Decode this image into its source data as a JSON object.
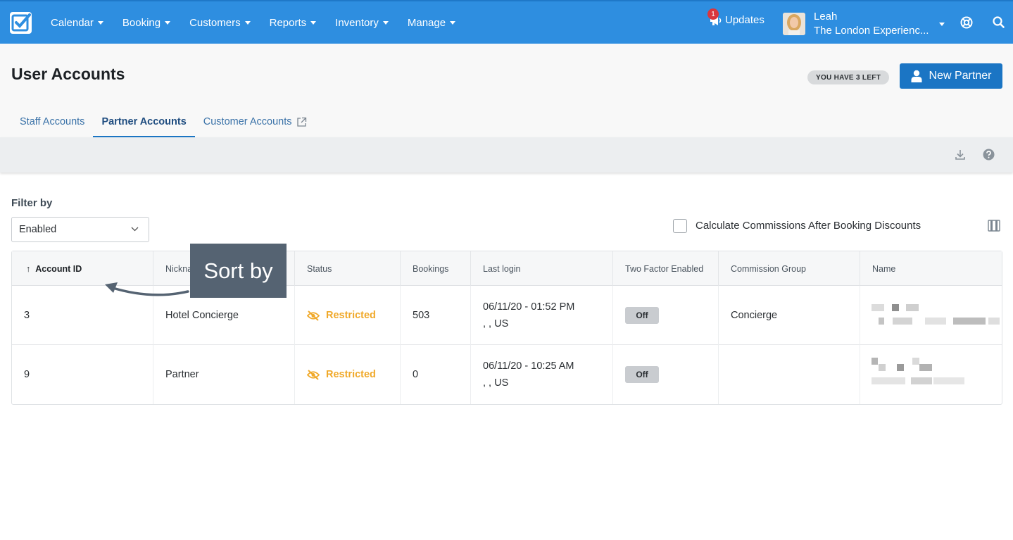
{
  "nav": {
    "items": [
      {
        "label": "Calendar"
      },
      {
        "label": "Booking"
      },
      {
        "label": "Customers"
      },
      {
        "label": "Reports"
      },
      {
        "label": "Inventory"
      },
      {
        "label": "Manage"
      }
    ],
    "updates_label": "Updates",
    "updates_count": "1",
    "user_name": "Leah",
    "user_company": "The London Experienc...",
    "icons": [
      "checkbox-logo-icon",
      "megaphone-icon",
      "lifebuoy-icon",
      "search-icon"
    ]
  },
  "page": {
    "title": "User Accounts",
    "remaining_label": "YOU HAVE 3 LEFT",
    "new_partner_label": "New Partner",
    "tabs": [
      {
        "label": "Staff Accounts"
      },
      {
        "label": "Partner Accounts"
      },
      {
        "label": "Customer Accounts"
      }
    ],
    "active_tab": "Partner Accounts"
  },
  "filter": {
    "label": "Filter by",
    "value": "Enabled"
  },
  "commissions": {
    "label": "Calculate Commissions After Booking Discounts",
    "checked": false
  },
  "tooltip": {
    "label": "Sort by"
  },
  "table": {
    "columns": [
      "Account ID",
      "Nicknar",
      "Status",
      "Bookings",
      "Last login",
      "Two Factor Enabled",
      "Commission Group",
      "Name"
    ],
    "sorted_column": "Account ID",
    "rows": [
      {
        "id": "3",
        "nickname": "Hotel Concierge",
        "status": "Restricted",
        "bookings": "503",
        "login_time": "06/11/20 - 01:52 PM",
        "login_location": ", , US",
        "two_factor": "Off",
        "commission_group": "Concierge"
      },
      {
        "id": "9",
        "nickname": "Partner",
        "status": "Restricted",
        "bookings": "0",
        "login_time": "06/11/20 - 10:25 AM",
        "login_location": ", , US",
        "two_factor": "Off",
        "commission_group": ""
      }
    ]
  },
  "colors": {
    "nav_bg": "#2e8ee0",
    "primary_button": "#1b75c4",
    "restricted": "#f0a92a",
    "tooltip_bg": "#556372"
  }
}
